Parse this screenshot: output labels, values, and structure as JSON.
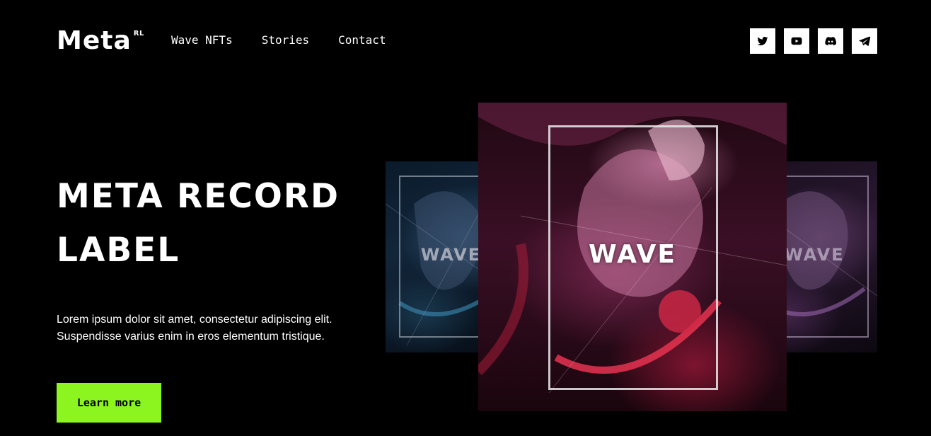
{
  "header": {
    "logo": {
      "text": "Meta",
      "superscript": "RL"
    },
    "nav": [
      {
        "label": "Wave NFTs"
      },
      {
        "label": "Stories"
      },
      {
        "label": "Contact"
      }
    ],
    "socials": [
      {
        "icon": "twitter-icon"
      },
      {
        "icon": "youtube-icon"
      },
      {
        "icon": "discord-icon"
      },
      {
        "icon": "telegram-icon"
      }
    ]
  },
  "hero": {
    "title": "META RECORD LABEL",
    "description": "Lorem ipsum dolor sit amet, consectetur adipiscing elit. Suspendisse varius enim in eros elementum tristique.",
    "cta_label": "Learn more"
  },
  "artwork": {
    "left_word": "WAVE",
    "center_word": "WAVE",
    "right_word": "WAVE"
  },
  "colors": {
    "background": "#000000",
    "accent": "#8cf520",
    "text": "#ffffff"
  }
}
